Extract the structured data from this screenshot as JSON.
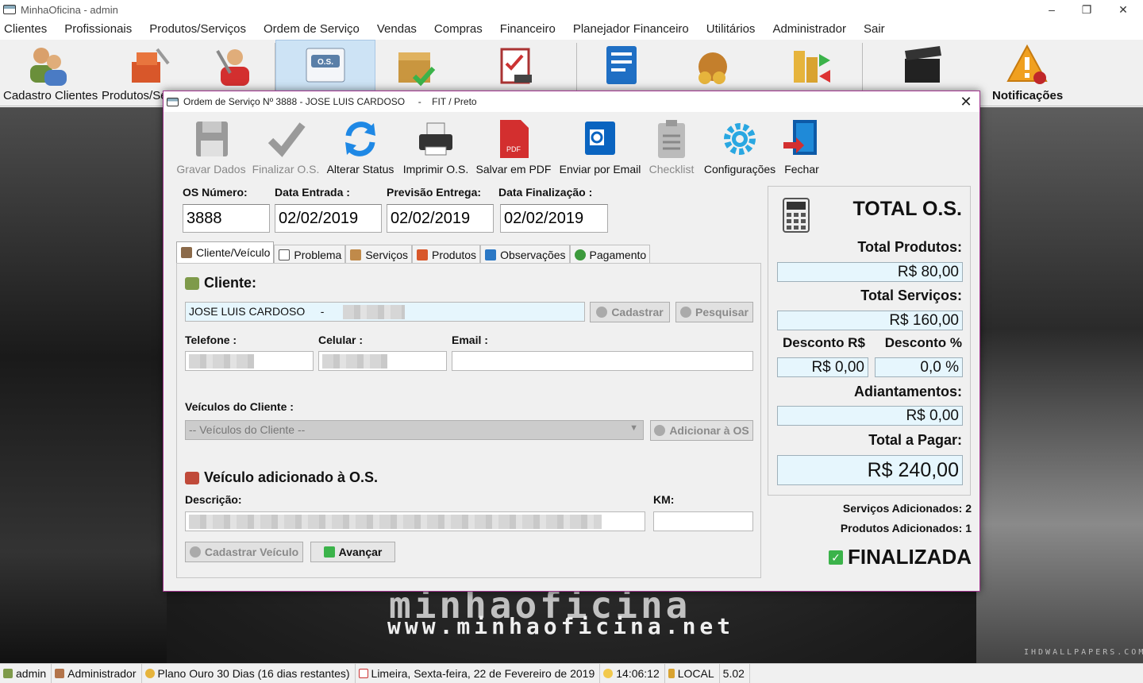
{
  "window": {
    "title": "MinhaOficina - admin"
  },
  "menu": [
    "Clientes",
    "Profissionais",
    "Produtos/Serviços",
    "Ordem de Serviço",
    "Vendas",
    "Compras",
    "Financeiro",
    "Planejador Financeiro",
    "Utilitários",
    "Administrador",
    "Sair"
  ],
  "toolbar": {
    "cadastro_clientes": "Cadastro Clientes",
    "produtos": "Produtos/Se",
    "notificacoes": "Notificações",
    "os_icon_text": "O.S."
  },
  "background": {
    "brand": "minhaoficina",
    "url": "www.minhaoficina.net",
    "watermark": "IHDWALLPAPERS.COM"
  },
  "statusbar": {
    "user": "admin",
    "role": "Administrador",
    "plan": "Plano Ouro 30 Dias (16 dias restantes)",
    "date": "Limeira, Sexta-feira, 22 de Fevereiro de 2019",
    "time": "14:06:12",
    "db": "LOCAL",
    "version": "5.02"
  },
  "dialog": {
    "title": "Ordem de Serviço Nº 3888 - JOSE LUIS CARDOSO     -    FIT / Preto",
    "buttons": {
      "gravar": "Gravar Dados",
      "finalizar": "Finalizar O.S.",
      "alterar": "Alterar Status",
      "imprimir": "Imprimir O.S.",
      "pdf": "Salvar em PDF",
      "email": "Enviar por Email",
      "checklist": "Checklist",
      "config": "Configurações",
      "fechar": "Fechar"
    },
    "fields": {
      "os_numero_label": "OS Número:",
      "os_numero": "3888",
      "data_entrada_label": "Data Entrada :",
      "data_entrada": "02/02/2019",
      "previsao_label": "Previsão Entrega:",
      "previsao": "02/02/2019",
      "finalizacao_label": "Data Finalização :",
      "finalizacao": "02/02/2019"
    },
    "tabs": [
      "Cliente/Veículo",
      "Problema",
      "Serviços",
      "Produtos",
      "Observações",
      "Pagamento"
    ],
    "cliente": {
      "section": "Cliente:",
      "name": "JOSE LUIS CARDOSO     -",
      "cadastrar": "Cadastrar",
      "pesquisar": "Pesquisar",
      "telefone_label": "Telefone :",
      "celular_label": "Celular :",
      "email_label": "Email :",
      "veiculos_label": "Veículos do Cliente :",
      "veiculos_placeholder": "-- Veículos do Cliente --",
      "adicionar": "Adicionar à OS"
    },
    "veiculo": {
      "section": "Veículo adicionado à O.S.",
      "descricao_label": "Descrição:",
      "km_label": "KM:",
      "cadastrar": "Cadastrar Veículo",
      "avancar": "Avançar"
    },
    "totals": {
      "title": "TOTAL O.S.",
      "produtos_label": "Total Produtos:",
      "produtos": "R$ 80,00",
      "servicos_label": "Total Serviços:",
      "servicos": "R$ 160,00",
      "desconto_rs_label": "Desconto R$",
      "desconto_rs": "R$ 0,00",
      "desconto_pct_label": "Desconto %",
      "desconto_pct": "0,0 %",
      "adiantamentos_label": "Adiantamentos:",
      "adiantamentos": "R$ 0,00",
      "pagar_label": "Total a Pagar:",
      "pagar": "R$ 240,00"
    },
    "info": {
      "servicos": "Serviços Adicionados: 2",
      "produtos": "Produtos Adicionados: 1",
      "status": "FINALIZADA"
    }
  }
}
